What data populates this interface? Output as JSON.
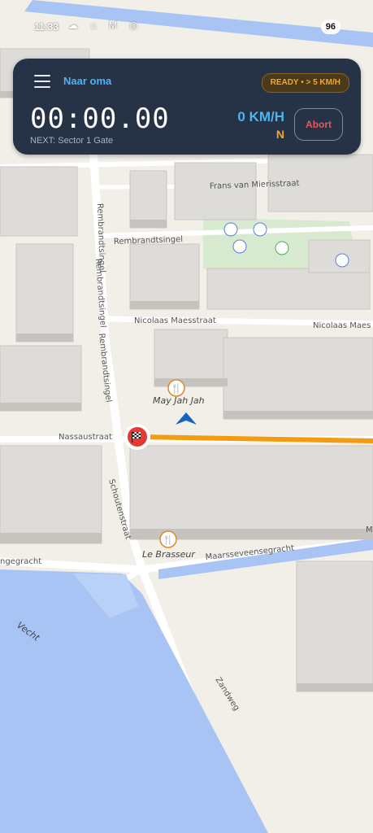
{
  "status_bar": {
    "time": "11:33",
    "icons": "☁ ⌂ M ◎",
    "battery": "96"
  },
  "hud": {
    "route_title": "Naar oma",
    "ready_badge": "READY • > 5 KM/H",
    "timer": "00:00.00",
    "next_label": "NEXT: Sector 1 Gate",
    "speed": "0 KM/H",
    "heading": "N",
    "abort_label": "Abort"
  },
  "map": {
    "streets": [
      "Frans van Mierisstraat",
      "Rembrandtsingel",
      "Nicolaas Maesstraat",
      "Nicolaas Maes",
      "Nassaustraat",
      "Schoutenstraat",
      "Maarsseveensegracht",
      "Zandweg",
      "ngegracht",
      "Rembrandtsingel",
      "Rembrandtsingel",
      "Rembrandtsingel"
    ],
    "water_label": "Vecht",
    "pois": [
      "May Jah Jah",
      "Le Brasseur"
    ],
    "edge_letter": "M",
    "colors": {
      "route": "#f39c12",
      "water": "#a8c4f5",
      "park": "#d7ead0",
      "finish": "#e53935"
    }
  }
}
